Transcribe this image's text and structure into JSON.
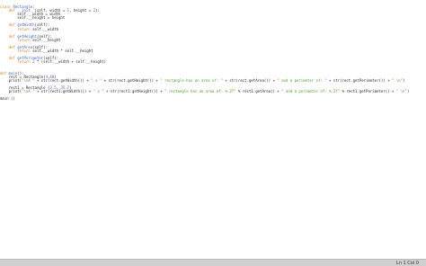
{
  "editor": {
    "lines": [
      [
        {
          "t": "class ",
          "c": "kw"
        },
        {
          "t": "Rectangle",
          "c": "fn"
        },
        {
          "t": ":",
          "c": ""
        }
      ],
      [
        {
          "t": "    ",
          "c": ""
        },
        {
          "t": "def ",
          "c": "kw"
        },
        {
          "t": "__init__",
          "c": "fn"
        },
        {
          "t": "(self, width = ",
          "c": ""
        },
        {
          "t": "1",
          "c": "num"
        },
        {
          "t": ", height = ",
          "c": ""
        },
        {
          "t": "2",
          "c": "num"
        },
        {
          "t": "):",
          "c": ""
        }
      ],
      [
        {
          "t": "        self.__width = width",
          "c": ""
        }
      ],
      [
        {
          "t": "        self.__height = height",
          "c": ""
        }
      ],
      [
        {
          "t": "",
          "c": ""
        }
      ],
      [
        {
          "t": "    ",
          "c": ""
        },
        {
          "t": "def ",
          "c": "kw"
        },
        {
          "t": "getWidth",
          "c": "fn"
        },
        {
          "t": "(self):",
          "c": ""
        }
      ],
      [
        {
          "t": "        ",
          "c": ""
        },
        {
          "t": "return ",
          "c": "kw"
        },
        {
          "t": "self.__width",
          "c": ""
        }
      ],
      [
        {
          "t": "",
          "c": ""
        }
      ],
      [
        {
          "t": "    ",
          "c": ""
        },
        {
          "t": "def ",
          "c": "kw"
        },
        {
          "t": "getHeight",
          "c": "fn"
        },
        {
          "t": "(self):",
          "c": ""
        }
      ],
      [
        {
          "t": "        ",
          "c": ""
        },
        {
          "t": "return ",
          "c": "kw"
        },
        {
          "t": "self.__height",
          "c": ""
        }
      ],
      [
        {
          "t": "",
          "c": ""
        }
      ],
      [
        {
          "t": "    ",
          "c": ""
        },
        {
          "t": "def ",
          "c": "kw"
        },
        {
          "t": "getArea",
          "c": "fn"
        },
        {
          "t": "(self):",
          "c": ""
        }
      ],
      [
        {
          "t": "        ",
          "c": ""
        },
        {
          "t": "return ",
          "c": "kw"
        },
        {
          "t": "self.__width * self.__height",
          "c": ""
        }
      ],
      [
        {
          "t": "",
          "c": ""
        }
      ],
      [
        {
          "t": "    ",
          "c": ""
        },
        {
          "t": "def ",
          "c": "kw"
        },
        {
          "t": "getPerimeter",
          "c": "fn"
        },
        {
          "t": "(self):",
          "c": ""
        }
      ],
      [
        {
          "t": "        ",
          "c": ""
        },
        {
          "t": "return ",
          "c": "kw"
        },
        {
          "t": "2",
          "c": "num"
        },
        {
          "t": " * (self.__width + self.__height)",
          "c": ""
        }
      ],
      [
        {
          "t": "",
          "c": ""
        }
      ],
      [
        {
          "t": "",
          "c": ""
        }
      ],
      [
        {
          "t": "def ",
          "c": "kw"
        },
        {
          "t": "main",
          "c": "fn"
        },
        {
          "t": "():",
          "c": ""
        }
      ],
      [
        {
          "t": "    rect = Rectangle(",
          "c": ""
        },
        {
          "t": "4",
          "c": "num"
        },
        {
          "t": ",",
          "c": ""
        },
        {
          "t": "40",
          "c": "num"
        },
        {
          "t": ")",
          "c": ""
        }
      ],
      [
        {
          "t": "    print(",
          "c": ""
        },
        {
          "t": "\"\\nA \"",
          "c": "str"
        },
        {
          "t": " + str(rect.getWidth()) + ",
          "c": ""
        },
        {
          "t": "\" x \"",
          "c": "str"
        },
        {
          "t": " + str(rect.getHeight()) + ",
          "c": ""
        },
        {
          "t": "\" rectangle has an area of: \"",
          "c": "str"
        },
        {
          "t": " + str(rect.getArea()) + ",
          "c": ""
        },
        {
          "t": "\" and a perimeter of: \"",
          "c": "str"
        },
        {
          "t": " + str(rect.getPerimeter()) + ",
          "c": ""
        },
        {
          "t": "\" \\n\"",
          "c": "str"
        },
        {
          "t": ")",
          "c": ""
        }
      ],
      [
        {
          "t": "",
          "c": ""
        }
      ],
      [
        {
          "t": "    rect1 = Rectangle (",
          "c": ""
        },
        {
          "t": "3.5",
          "c": "num"
        },
        {
          "t": ", ",
          "c": ""
        },
        {
          "t": "35.7",
          "c": "num"
        },
        {
          "t": ")",
          "c": ""
        }
      ],
      [
        {
          "t": "    print(",
          "c": ""
        },
        {
          "t": "\"\\nA \"",
          "c": "str"
        },
        {
          "t": " + str(rect1.getWidth()) + ",
          "c": ""
        },
        {
          "t": "\" x \"",
          "c": "str"
        },
        {
          "t": " + str(rect1.getHeight()) + ",
          "c": ""
        },
        {
          "t": "\" rectangle has an area of: %.2f\"",
          "c": "str"
        },
        {
          "t": " % rect1.getArea() + ",
          "c": ""
        },
        {
          "t": "\" and a perimeter of: %.2f\"",
          "c": "str"
        },
        {
          "t": " % rect1.getPerimeter() + ",
          "c": ""
        },
        {
          "t": "\" \\n\"",
          "c": "str"
        },
        {
          "t": ")",
          "c": ""
        }
      ],
      [
        {
          "t": "",
          "c": ""
        }
      ],
      [
        {
          "t": "main ()",
          "c": ""
        }
      ]
    ]
  },
  "statusbar": {
    "cursor_position": "Ln 1  Col 0"
  }
}
